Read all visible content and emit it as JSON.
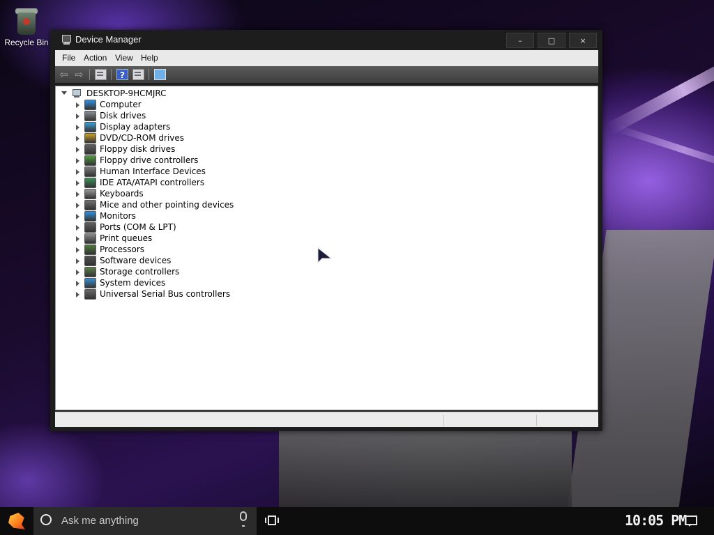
{
  "desktop": {
    "icons": [
      {
        "label": "Recycle Bin",
        "icon": "recycle-bin-icon"
      }
    ]
  },
  "window": {
    "title": "Device Manager",
    "title_icon": "device-manager-icon",
    "controls": {
      "minimize": "–",
      "maximize": "□",
      "close": "×"
    },
    "menu": [
      "File",
      "Action",
      "View",
      "Help"
    ],
    "toolbar": [
      {
        "name": "back",
        "glyph": "⇦",
        "icon": "back-arrow-icon"
      },
      {
        "name": "forward",
        "glyph": "⇨",
        "icon": "forward-arrow-icon"
      },
      {
        "name": "properties",
        "icon": "properties-icon"
      },
      {
        "name": "help",
        "glyph": "?",
        "icon": "help-icon"
      },
      {
        "name": "view-sheet",
        "icon": "sheet-icon"
      },
      {
        "name": "scan-hardware",
        "icon": "scan-monitor-icon"
      }
    ],
    "tree": {
      "root": "DESKTOP-9HCMJRC",
      "categories": [
        {
          "label": "Computer",
          "color": "#2f8fe0"
        },
        {
          "label": "Disk drives",
          "color": "#8a8f96"
        },
        {
          "label": "Display adapters",
          "color": "#3aa0d8"
        },
        {
          "label": "DVD/CD-ROM drives",
          "color": "#c9a227"
        },
        {
          "label": "Floppy disk drives",
          "color": "#606060"
        },
        {
          "label": "Floppy drive controllers",
          "color": "#4e9a3e"
        },
        {
          "label": "Human Interface Devices",
          "color": "#7a7a7a"
        },
        {
          "label": "IDE ATA/ATAPI controllers",
          "color": "#3e8e5a"
        },
        {
          "label": "Keyboards",
          "color": "#9a9a9a"
        },
        {
          "label": "Mice and other pointing devices",
          "color": "#707070"
        },
        {
          "label": "Monitors",
          "color": "#2f8fe0"
        },
        {
          "label": "Ports (COM & LPT)",
          "color": "#606060"
        },
        {
          "label": "Print queues",
          "color": "#8a8a8a"
        },
        {
          "label": "Processors",
          "color": "#4f7a3a"
        },
        {
          "label": "Software devices",
          "color": "#505050"
        },
        {
          "label": "Storage controllers",
          "color": "#5b7f4a"
        },
        {
          "label": "System devices",
          "color": "#3a8fd0"
        },
        {
          "label": "Universal Serial Bus controllers",
          "color": "#6a6a6a"
        }
      ]
    }
  },
  "taskbar": {
    "start_icon": "start-logo-icon",
    "search_placeholder": "Ask me anything",
    "clock": "10:05 PM"
  }
}
